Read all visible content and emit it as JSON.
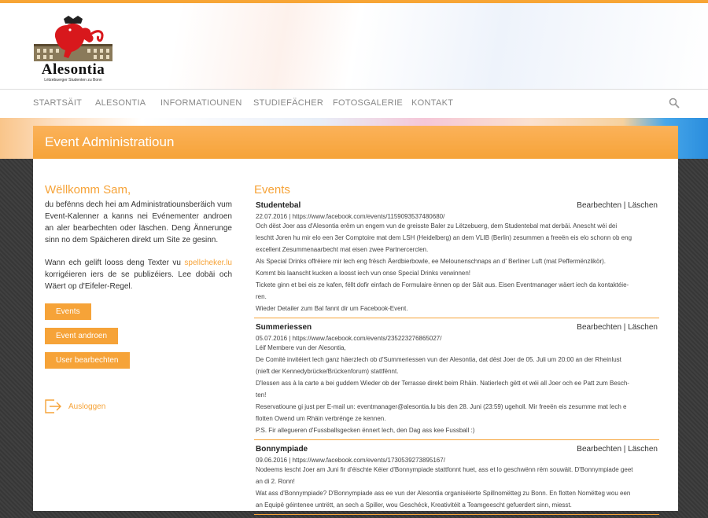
{
  "brand": {
    "name": "Alesontia",
    "tagline": "Lëtzebuerger Studenten zu Bonn",
    "accent": "#f6a338"
  },
  "nav": {
    "items": [
      "STARTSÄIT",
      "ALESONTIA",
      "INFORMATIOUNEN",
      "STUDIEFÄCHER",
      "FOTOSGALERIE",
      "KONTAKT"
    ]
  },
  "page": {
    "title": "Event Administratioun"
  },
  "left": {
    "welcome": "Wëllkomm Sam,",
    "intro1": "du befënns dech hei am Administratiounsberäich vum Event-Kalenner a kanns nei Evénementer androen an aler bearbechten oder läschen. Deng Ännerunge sinn no dem Späicheren direkt um Site ze gesinn.",
    "intro2a": "Wann ech gelift looss deng Texter vu ",
    "intro2link": "spellcheker.lu",
    "intro2b": " korrigéieren iers de se publizéiers. Lee dobäi och Wäert op d'Eifeler-Regel.",
    "buttons": [
      "Events",
      "Event androen",
      "User bearbechten"
    ],
    "logout": "Ausloggen"
  },
  "events": {
    "heading": "Events",
    "edit": "Bearbechten",
    "sep": "|",
    "delete": "Läschen",
    "items": [
      {
        "title": "Studentebal",
        "meta": "22.07.2016 | https://www.facebook.com/events/1159093537480680/",
        "lines": [
          "Och dëst Joer ass d'Alesontia erëm un engem vun de greisste Baler zu Lëtzebuerg, dem Studentebal mat derbäi. Anescht wéi dei",
          "leschtt Joren hu mir elo een 3er Comptoire mat dem LSH (Heidelberg) an dem VLIB (Berlin) zesummen a freeën eis elo schonn ob eng",
          "excellent Zesummenaarbecht mat eisen zwee Partnercerclen.",
          "Als Special Drinks offréiere mir lech eng frësch Äerdbierbowle, ee Melounenschnaps an d' Berliner Luft (mat Peffermënzlikör).",
          "Kommt bis laanscht kucken a loosst iech vun onse Special Drinks verwinnen!",
          "Tickete ginn et bei eis ze kafen, fëllt dofir einfach de Formulaire ënnen op der Säit aus. Eisen Eventmanager wäert iech da kontaktéie-",
          "ren.",
          "Wieder Detailer zum Bal fannt dir um Facebook-Event."
        ]
      },
      {
        "title": "Summeriessen",
        "meta": "05.07.2016 | https://www.facebook.com/events/235223276865027/",
        "lines": [
          "Léif Membere vun der Alesontia,",
          "De Comité invitéiert lech ganz häerzlech ob d'Summeriessen vun der Alesontia, dat dëst Joer de 05. Juli um 20:00 an der Rheinlust",
          "(nieft der Kennedybrücke/Brückenforum) stattfënnt.",
          "D'lessen ass à la carte a bei guddem Wieder ob der Terrasse direkt beim Rhäin. Natierlech gëtt et wéi all Joer och ee Patt zum Besch-",
          "ten!",
          "Reservatioune gi just per E-mail un: eventmanager@alesontia.lu bis den 28. Juni (23:59) ugeholl. Mir freeën eis zesumme mat lech e",
          "flotten Owend um Rhäin verbrénge ze kennen.",
          "P.S. Fir allegueren d'Fussballsgecken ënnert lech, den Dag ass kee Fussball :)"
        ]
      },
      {
        "title": "Bonnympiade",
        "meta": "09.06.2016 | https://www.facebook.com/events/1730539273895167/",
        "lines": [
          "Nodeems lescht Joer am Juni fir d'éischte Kéier d'Bonnympiade stattfonnt huet, ass et lo geschwënn rëm souwäit. D'Bonnympiade geet",
          "an di 2. Ronn!",
          "Wat ass d'Bonnympiade? D'Bonnympiade ass ee vun der Alesontia organiséierte Spillnomëtteg zu Bonn. En flotten Nomëtteg wou een",
          "an Equipë géintenee untrëtt, an sech a Spiller, wou Geschéck, Kreativitéit a Teamgeescht gefuerdert sinn, miesst."
        ]
      }
    ]
  }
}
